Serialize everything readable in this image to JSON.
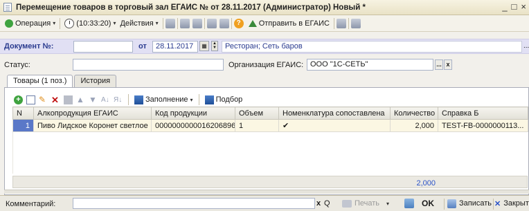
{
  "window": {
    "title": "Перемещение товаров в торговый зал ЕГАИС № от 28.11.2017 (Администратор) Новый *",
    "minimize": "_",
    "maximize": "□",
    "close": "×"
  },
  "toolbar": {
    "operation": "Операция",
    "time": "(10:33:20)",
    "actions": "Действия",
    "send": "Отправить в ЕГАИС"
  },
  "document": {
    "number_label": "Документ №:",
    "number_value": "",
    "date_label": "от",
    "date_value": "28.11.2017",
    "warehouse": "Ресторан; Сеть баров",
    "ellipsis": "..."
  },
  "status": {
    "label": "Статус:",
    "value": ""
  },
  "organization": {
    "label": "Организация ЕГАИС:",
    "value": "ООО \"1С-СЕТЬ\"",
    "select": "...",
    "clear": "x"
  },
  "tabs": [
    {
      "label": "Товары (1 поз.)"
    },
    {
      "label": "История"
    }
  ],
  "table_toolbar": {
    "fill": "Заполнение",
    "pick": "Подбор"
  },
  "table": {
    "columns": [
      "N",
      "Алкопродукция ЕГАИС",
      "Код продукции",
      "Объем",
      "Номенклатура сопоставлена",
      "Количество",
      "Справка Б"
    ],
    "rows": [
      {
        "n": "1",
        "product": "Пиво Лидское Коронет светлое",
        "code": "0000000000016206896",
        "volume": "1",
        "matched": "✔",
        "quantity": "2,000",
        "cert": "TEST-FB-0000000113..."
      }
    ],
    "total_quantity": "2,000"
  },
  "bottom": {
    "comment_label": "Комментарий:",
    "comment_value": "",
    "clear": "x",
    "search": "Q",
    "print": "Печать",
    "ok": "OK",
    "save": "Записать",
    "close": "Закрыть"
  },
  "colors": {
    "accent_blue": "#2a3b8f",
    "selection": "#5a78c8",
    "total_blue": "#2a52c8"
  }
}
